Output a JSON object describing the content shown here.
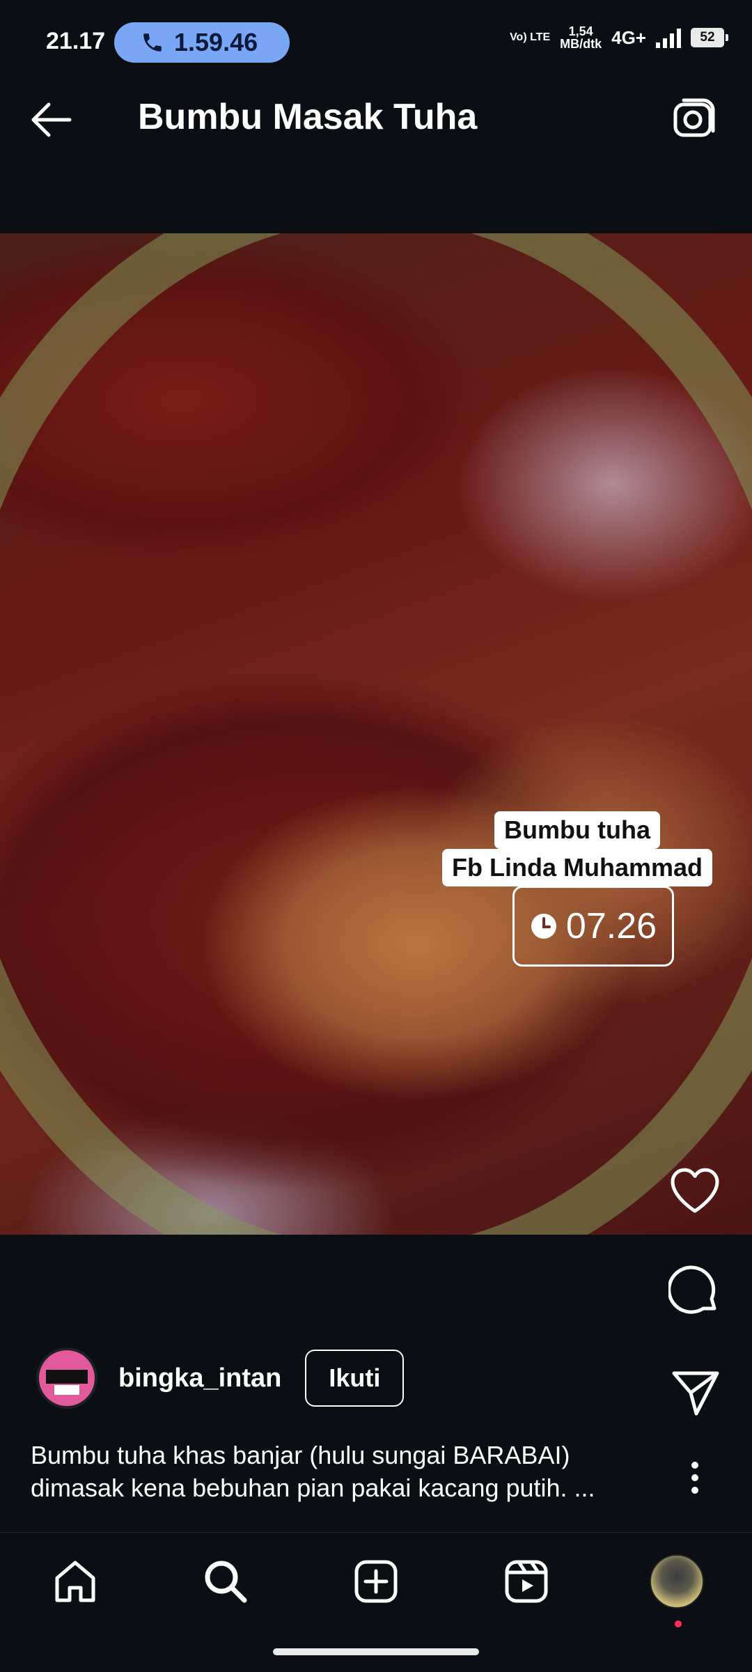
{
  "status_bar": {
    "time": "21.17",
    "call_timer": "1.59.46",
    "volte": "Vo) LTE",
    "net_speed_value": "1,54",
    "net_speed_unit": "MB/dtk",
    "network": "4G+",
    "battery": "52"
  },
  "header": {
    "title": "Bumbu Masak Tuha"
  },
  "post": {
    "overlay_line1": "Bumbu tuha",
    "overlay_line2": "Fb Linda Muhammad",
    "overlay_timer": "07.26",
    "author": {
      "username": "bingka_intan",
      "follow_label": "Ikuti"
    },
    "caption_line1": "Bumbu tuha khas banjar (hulu sungai BARABAI)",
    "caption_line2": "dimasak kena bebuhan pian pakai kacang putih. ..."
  },
  "icons": {
    "back": "arrow-left-icon",
    "camera": "camera-icon",
    "like": "heart-icon",
    "comment": "comment-icon",
    "share": "send-icon",
    "more": "more-vertical-icon",
    "home": "home-icon",
    "search": "search-icon",
    "create": "plus-square-icon",
    "reels": "reels-icon",
    "profile": "profile-avatar"
  },
  "colors": {
    "background": "#0b0f14",
    "call_pill": "#7aa6f6",
    "notification_dot": "#ff2d55"
  }
}
